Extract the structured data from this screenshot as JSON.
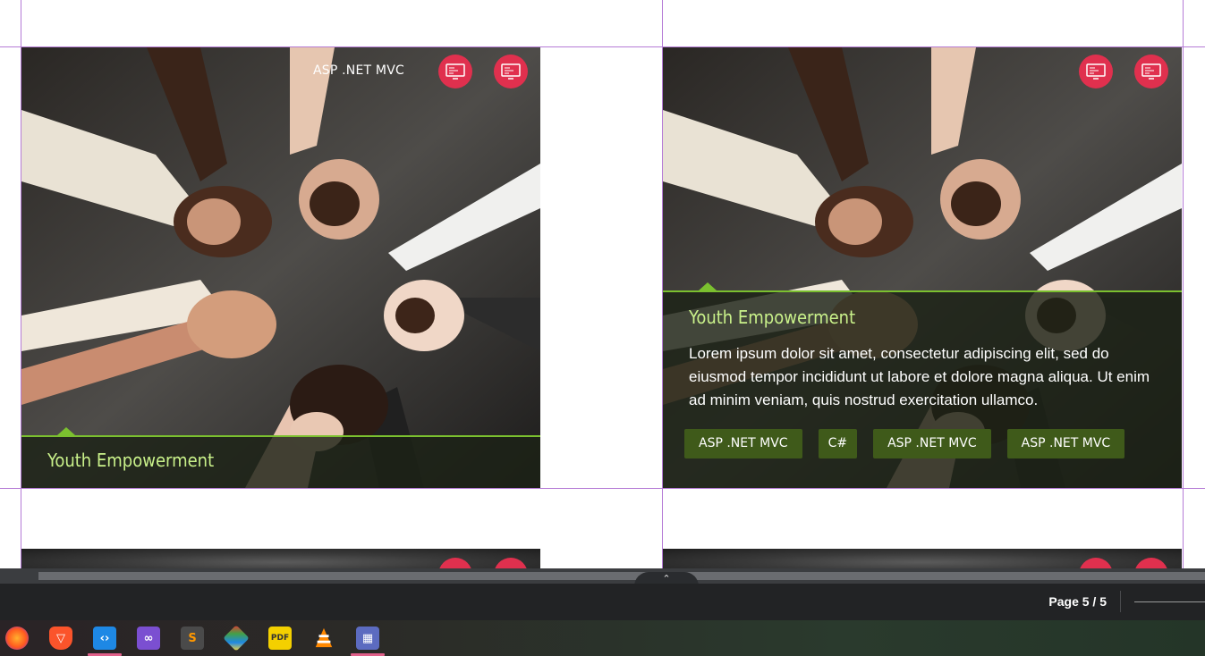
{
  "cards": [
    {
      "top_tag": "ASP .NET MVC",
      "title": "Youth Empowerment"
    },
    {
      "title": "Youth Empowerment",
      "description": "Lorem ipsum dolor sit amet, consectetur adipiscing elit, sed do eiusmod tempor incididunt ut labore et dolore magna aliqua. Ut enim ad minim veniam, quis nostrud exercitation ullamco.",
      "tags": [
        "ASP .NET MVC",
        "C#",
        "ASP .NET MVC",
        "ASP .NET MVC"
      ]
    }
  ],
  "colors": {
    "accent_red": "#e0304e",
    "accent_green": "#7bc02f",
    "title_green": "#c9f18a",
    "chip_bg": "#3f5a1a"
  },
  "icons": {
    "card_action": "monitor-code-icon"
  },
  "scroll": {
    "tab_glyph": "⌃"
  },
  "status": {
    "page_indicator": "Page 5 / 5"
  },
  "taskbar": {
    "apps": [
      "firefox-icon",
      "brave-icon",
      "vscode-icon",
      "visual-studio-icon",
      "sublime-text-icon",
      "git-icon",
      "pdf-icon",
      "vlc-icon",
      "calculator-icon"
    ]
  }
}
